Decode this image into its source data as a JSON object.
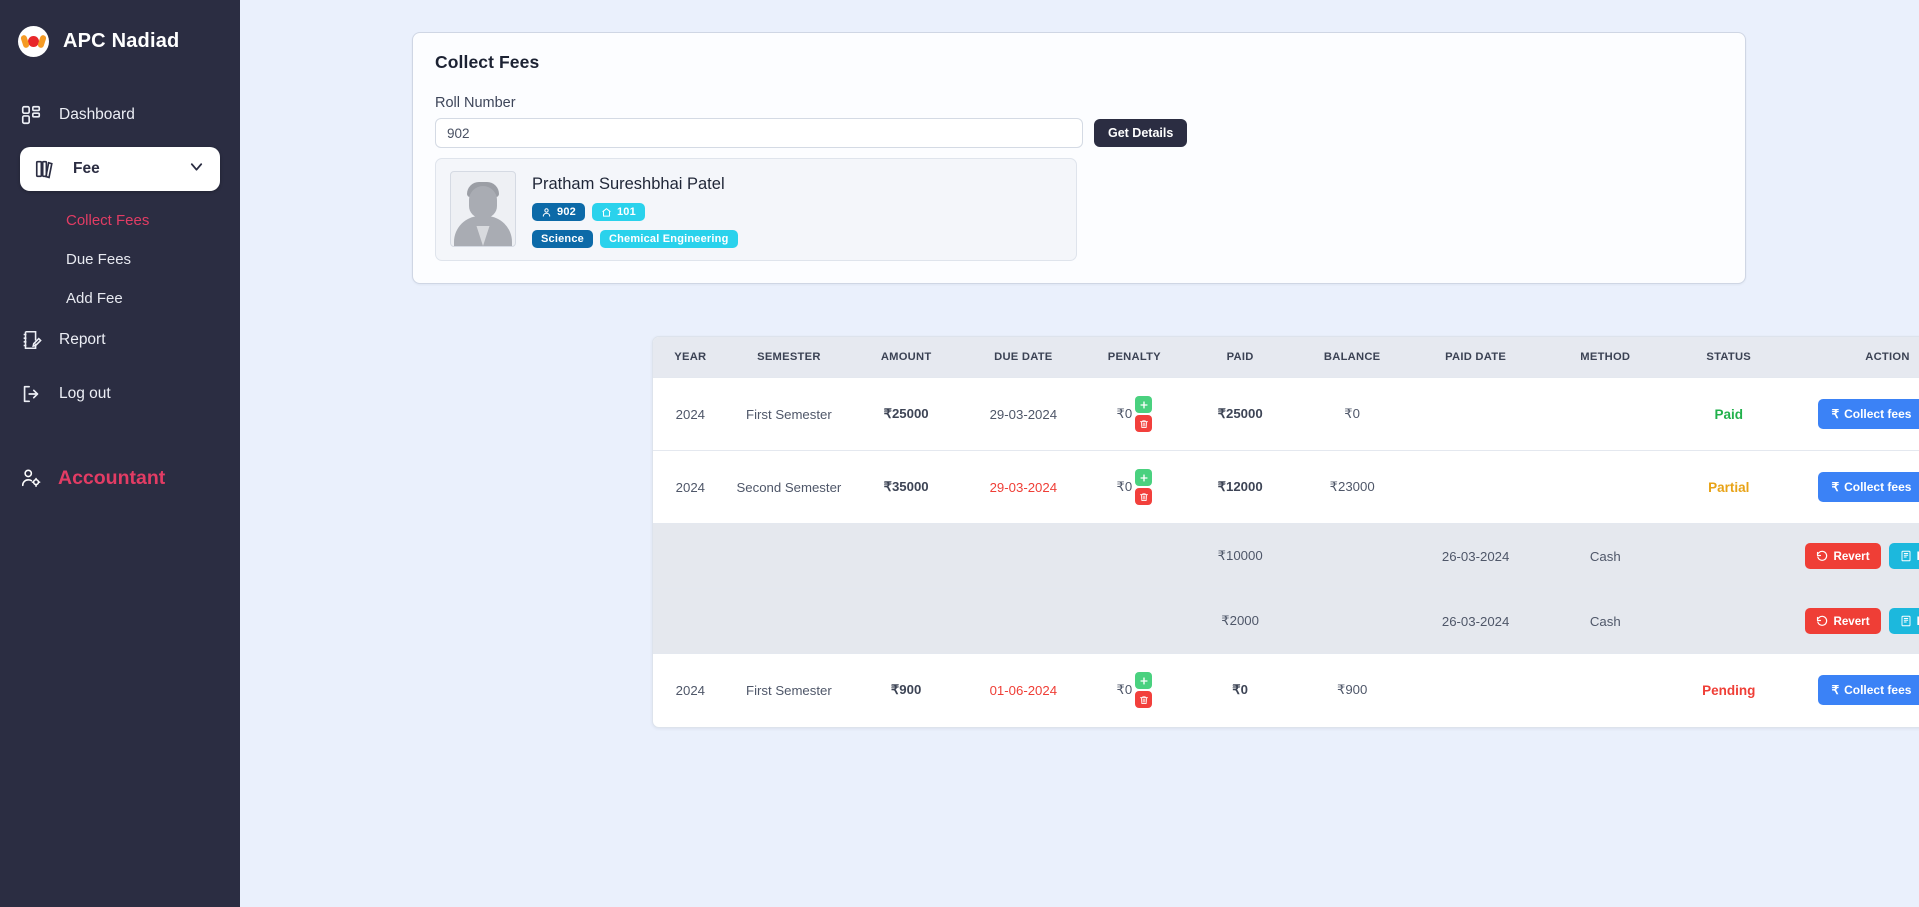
{
  "sidebar": {
    "brand": "APC Nadiad",
    "items": [
      {
        "label": "Dashboard",
        "icon": "dashboard-icon"
      },
      {
        "label": "Fee",
        "icon": "book-icon",
        "active": true,
        "chevron": "chevron-down-icon"
      },
      {
        "label": "Report",
        "icon": "report-icon"
      },
      {
        "label": "Log out",
        "icon": "logout-icon"
      }
    ],
    "sub_items": [
      {
        "label": "Collect Fees",
        "selected": true
      },
      {
        "label": "Due Fees",
        "selected": false
      },
      {
        "label": "Add Fee",
        "selected": false
      }
    ],
    "role": {
      "label": "Accountant",
      "icon": "user-gear-icon"
    },
    "accent_color": "#e23c64",
    "background_color": "#2b2d42"
  },
  "collect_card": {
    "title": "Collect Fees",
    "roll_label": "Roll Number",
    "roll_value": "902",
    "roll_placeholder": "Roll Number",
    "get_details_label": "Get Details",
    "student": {
      "name": "Pratham Sureshbhai Patel",
      "avatar": "user-placeholder-avatar",
      "badges": [
        {
          "text": "902",
          "icon": "person-icon",
          "style": "dark"
        },
        {
          "text": "101",
          "icon": "home-icon",
          "style": "cyan"
        }
      ],
      "tags": [
        {
          "text": "Science",
          "style": "dark"
        },
        {
          "text": "Chemical Engineering",
          "style": "cyan"
        }
      ]
    }
  },
  "table": {
    "columns": [
      "YEAR",
      "SEMESTER",
      "AMOUNT",
      "DUE DATE",
      "PENALTY",
      "PAID",
      "BALANCE",
      "PAID DATE",
      "METHOD",
      "STATUS",
      "ACTION"
    ],
    "rows": [
      {
        "type": "fee",
        "year": "2024",
        "semester": "First Semester",
        "amount": "₹25000",
        "due_date": "29-03-2024",
        "due_overdue": false,
        "penalty": "₹0",
        "paid": "₹25000",
        "balance": "₹0",
        "paid_date": "",
        "method": "",
        "status": "Paid",
        "status_style": "paid",
        "action_label": "Collect fees"
      },
      {
        "type": "fee",
        "year": "2024",
        "semester": "Second Semester",
        "amount": "₹35000",
        "due_date": "29-03-2024",
        "due_overdue": true,
        "penalty": "₹0",
        "paid": "₹12000",
        "balance": "₹23000",
        "paid_date": "",
        "method": "",
        "status": "Partial",
        "status_style": "partial",
        "action_label": "Collect fees"
      },
      {
        "type": "payment",
        "year": "",
        "semester": "",
        "amount": "",
        "due_date": "",
        "penalty": "",
        "paid": "₹10000",
        "balance": "",
        "paid_date": "26-03-2024",
        "method": "Cash",
        "status": "",
        "revert_label": "Revert",
        "receipt_label": "Reciept"
      },
      {
        "type": "payment",
        "year": "",
        "semester": "",
        "amount": "",
        "due_date": "",
        "penalty": "",
        "paid": "₹2000",
        "balance": "",
        "paid_date": "26-03-2024",
        "method": "Cash",
        "status": "",
        "revert_label": "Revert",
        "receipt_label": "Reciept"
      },
      {
        "type": "fee",
        "year": "2024",
        "semester": "First Semester",
        "amount": "₹900",
        "due_date": "01-06-2024",
        "due_overdue": true,
        "penalty": "₹0",
        "paid": "₹0",
        "balance": "₹900",
        "paid_date": "",
        "method": "",
        "status": "Pending",
        "status_style": "pending",
        "action_label": "Collect fees"
      }
    ]
  },
  "colors": {
    "page_background": "#eaf0fc",
    "primary_blue": "#3b82f6",
    "danger_red": "#f2403c",
    "success_green": "#22b14c",
    "warning_yellow": "#e8a317",
    "cyan": "#2ad2ec"
  }
}
